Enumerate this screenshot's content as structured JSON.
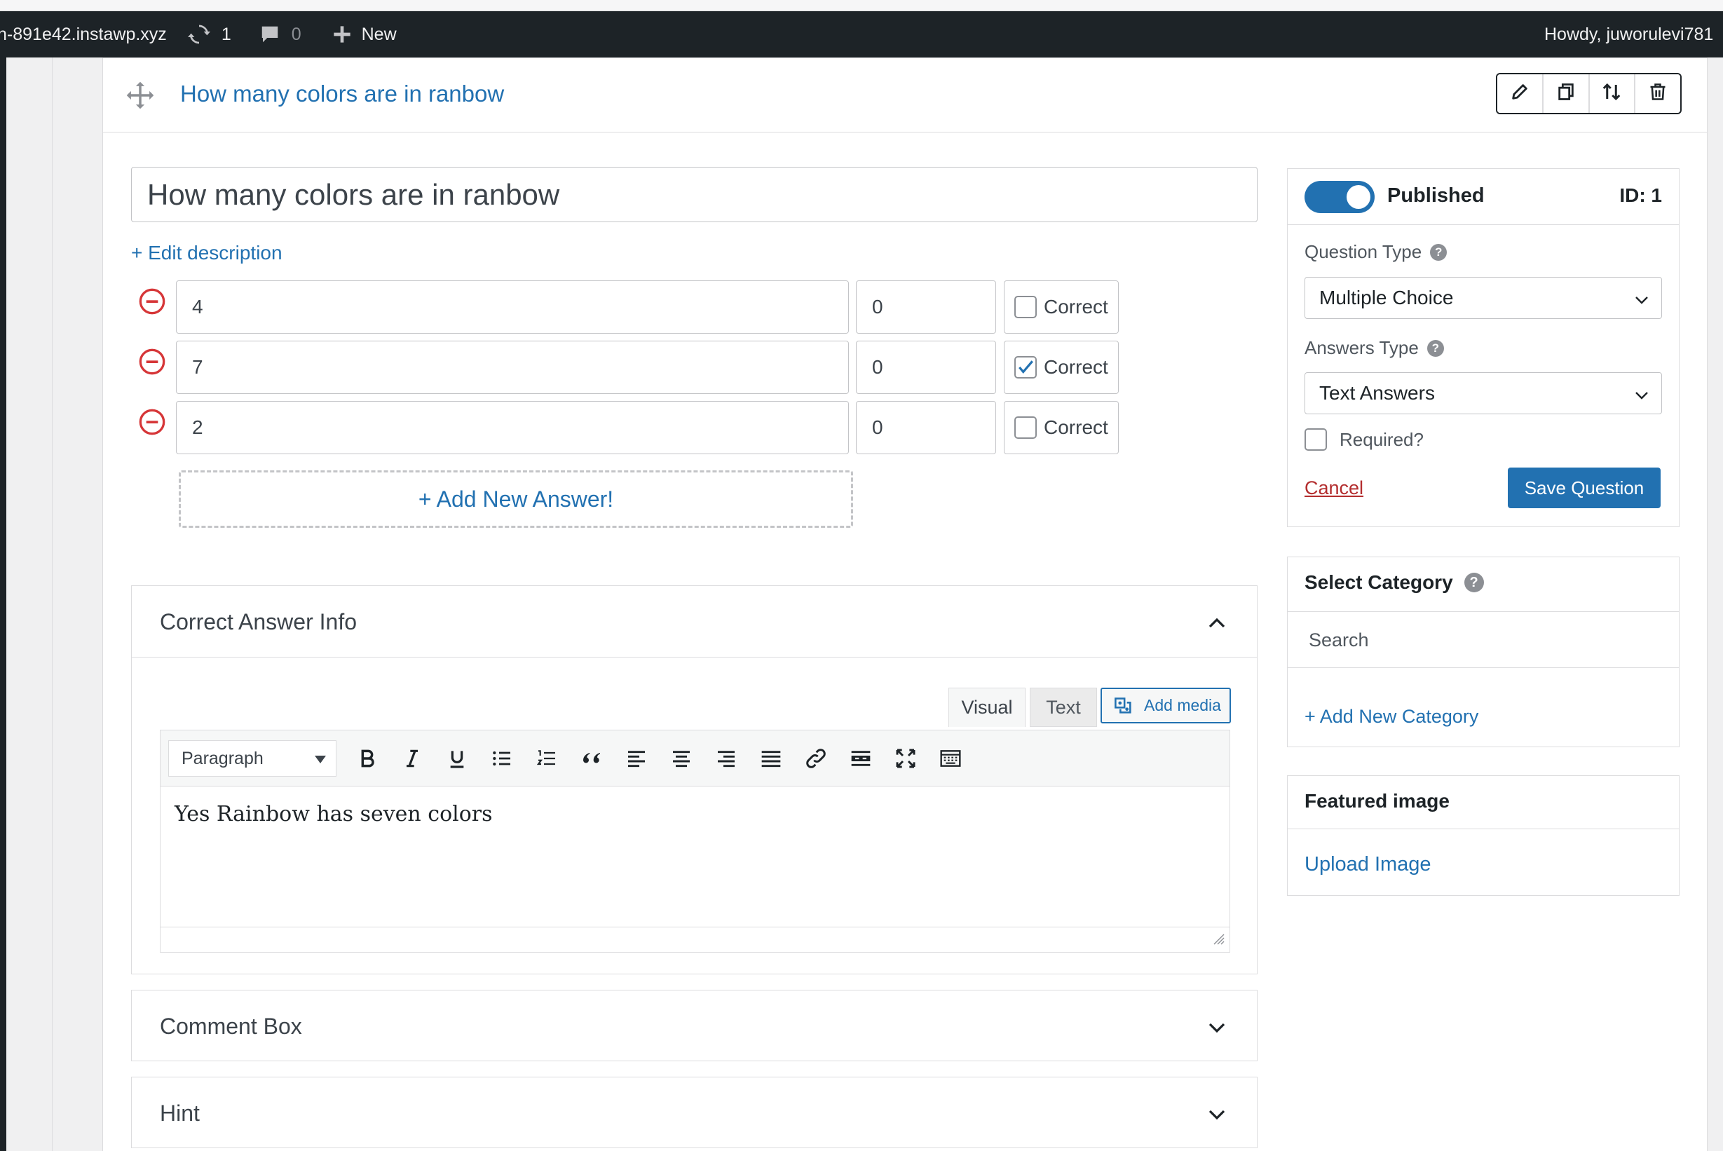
{
  "adminbar": {
    "site": "n-891e42.instawp.xyz",
    "updates_count": "1",
    "comments_count": "0",
    "new_label": "New",
    "howdy": "Howdy, juworulevi781"
  },
  "question": {
    "header_title": "How many colors are in ranbow",
    "title_value": "How many colors are in ranbow",
    "edit_description": "+ Edit description",
    "answers": [
      {
        "text": "4",
        "points": "0",
        "correct_label": "Correct",
        "correct": false
      },
      {
        "text": "7",
        "points": "0",
        "correct_label": "Correct",
        "correct": true
      },
      {
        "text": "2",
        "points": "0",
        "correct_label": "Correct",
        "correct": false
      }
    ],
    "add_answer": "+ Add New Answer!"
  },
  "correct_info": {
    "title": "Correct Answer Info",
    "tab_visual": "Visual",
    "tab_text": "Text",
    "add_media": "Add media",
    "format": "Paragraph",
    "content": "Yes Rainbow has seven colors"
  },
  "comment_box": {
    "title": "Comment Box"
  },
  "hint": {
    "title": "Hint"
  },
  "publish": {
    "status": "Published",
    "id": "ID: 1",
    "question_type_label": "Question Type",
    "question_type_value": "Multiple Choice",
    "answers_type_label": "Answers Type",
    "answers_type_value": "Text Answers",
    "required_label": "Required?",
    "cancel": "Cancel",
    "save": "Save Question"
  },
  "category": {
    "title": "Select Category",
    "search_placeholder": "Search",
    "add_new": "+ Add New Category"
  },
  "featured": {
    "title": "Featured image",
    "upload": "Upload Image"
  },
  "colors": {
    "accent": "#2271b1",
    "adminbar": "#1d2327",
    "danger": "#d63638"
  }
}
